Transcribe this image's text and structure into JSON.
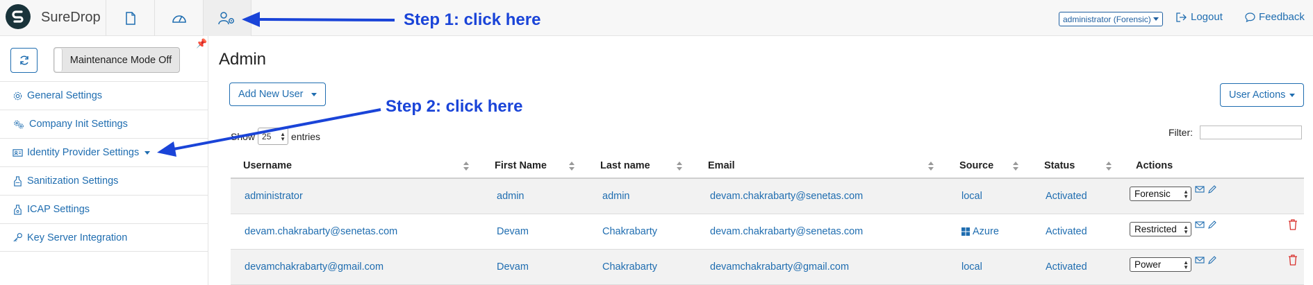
{
  "app": {
    "brand": "SureDrop"
  },
  "header": {
    "nav_tabs": [
      {
        "name": "document-icon"
      },
      {
        "name": "dashboard-icon"
      },
      {
        "name": "admin-users-icon"
      }
    ],
    "user_role_select": "administrator (Forensic)",
    "logout_label": "Logout",
    "feedback_label": "Feedback"
  },
  "sidebar": {
    "maintenance_label": "Maintenance Mode Off",
    "items": [
      {
        "label": "General Settings",
        "icon": "gear-icon"
      },
      {
        "label": "Company Init Settings",
        "icon": "gears-icon"
      },
      {
        "label": "Identity Provider Settings",
        "icon": "id-card-icon"
      },
      {
        "label": "Sanitization Settings",
        "icon": "sanitize-icon"
      },
      {
        "label": "ICAP Settings",
        "icon": "icap-icon"
      },
      {
        "label": "Key Server Integration",
        "icon": "key-icon"
      }
    ]
  },
  "main": {
    "title": "Admin",
    "add_user_label": "Add New User",
    "user_actions_label": "User Actions",
    "show_label": "Show",
    "entries_value": "25",
    "entries_label": "entries",
    "filter_label": "Filter:",
    "columns": [
      "Username",
      "First Name",
      "Last name",
      "Email",
      "Source",
      "Status",
      "Actions"
    ],
    "rows": [
      {
        "username": "administrator",
        "first": "admin",
        "last": "admin",
        "email": "devam.chakrabarty@senetas.com",
        "source": "local",
        "status": "Activated",
        "role": "Forensic",
        "deletable": false
      },
      {
        "username": "devam.chakrabarty@senetas.com",
        "first": "Devam",
        "last": "Chakrabarty",
        "email": "devam.chakrabarty@senetas.com",
        "source": "Azure",
        "status": "Activated",
        "role": "Restricted",
        "deletable": true
      },
      {
        "username": "devamchakrabarty@gmail.com",
        "first": "Devam",
        "last": "Chakrabarty",
        "email": "devamchakrabarty@gmail.com",
        "source": "local",
        "status": "Activated",
        "role": "Power",
        "deletable": true
      }
    ]
  },
  "annotations": {
    "step1": "Step 1: click here",
    "step2": "Step 2: click here"
  },
  "colors": {
    "link": "#1f6db0",
    "annotation": "#1a44d8",
    "danger": "#d9302c"
  }
}
